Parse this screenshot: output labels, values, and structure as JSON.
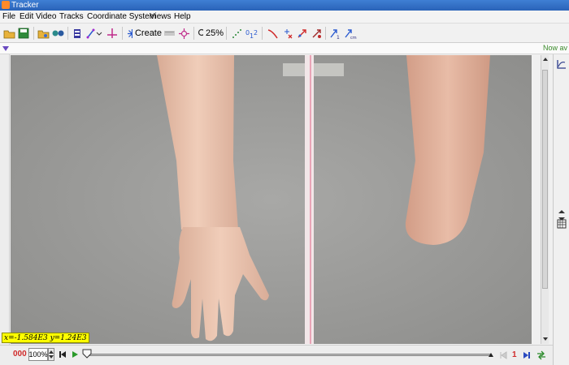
{
  "window": {
    "title": "Tracker"
  },
  "menu": [
    "File",
    "Edit",
    "Video",
    "Tracks",
    "Coordinate System",
    "Views",
    "Help"
  ],
  "toolbar": {
    "create_label": "Create",
    "zoom_label": "25%"
  },
  "notes": {
    "text": "Now av"
  },
  "readout": {
    "text": "x=-1.584E3  y=1.24E3"
  },
  "player": {
    "frame": "000",
    "rate": "100%",
    "step": "1"
  }
}
